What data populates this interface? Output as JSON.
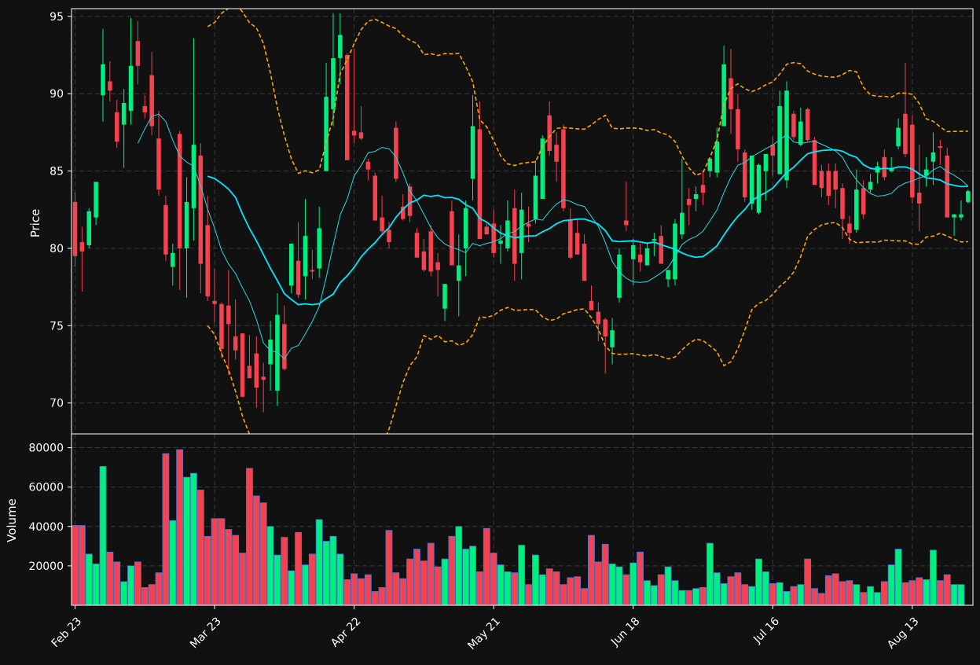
{
  "chart_data": {
    "type": "candlestick",
    "colors": {
      "background": "#111111",
      "up": "#00f080",
      "down": "#f44250",
      "sma_short": "#2ad8e0",
      "sma_long": "#00e8ff",
      "bollinger": "#ffa500",
      "grid": "#3a3a3a",
      "text": "#ffffff",
      "volume_edge": "#4a78d8"
    },
    "price_panel": {
      "ylabel": "Price",
      "ylim": [
        68,
        95.5
      ],
      "yticks": [
        70,
        75,
        80,
        85,
        90,
        95
      ]
    },
    "volume_panel": {
      "ylabel": "Volume",
      "ylim": [
        0,
        87000
      ],
      "yticks": [
        20000,
        40000,
        60000,
        80000
      ]
    },
    "x_axis": {
      "tick_labels": [
        "Feb 23",
        "Mar 23",
        "Apr 22",
        "May 21",
        "Jun 18",
        "Jul 16",
        "Aug 13"
      ],
      "tick_index": [
        0,
        20,
        40,
        60,
        80,
        100,
        120
      ],
      "n_bars": 128
    },
    "ohlc": [
      [
        83.0,
        83.6,
        78.8,
        79.5
      ],
      [
        80.4,
        81.4,
        77.2,
        79.8
      ],
      [
        80.2,
        82.6,
        80.0,
        82.4
      ],
      [
        82.0,
        84.2,
        81.5,
        84.3
      ],
      [
        89.9,
        94.2,
        88.2,
        91.9
      ],
      [
        90.8,
        92.1,
        89.5,
        90.2
      ],
      [
        88.8,
        89.6,
        86.5,
        86.9
      ],
      [
        88.0,
        90.3,
        85.2,
        89.4
      ],
      [
        88.9,
        94.9,
        88.0,
        91.8
      ],
      [
        93.4,
        94.7,
        90.6,
        91.8
      ],
      [
        89.2,
        89.9,
        88.4,
        88.8
      ],
      [
        91.2,
        92.7,
        87.3,
        87.9
      ],
      [
        87.1,
        88.9,
        83.4,
        83.8
      ],
      [
        82.8,
        83.4,
        79.2,
        79.6
      ],
      [
        78.8,
        80.3,
        77.6,
        79.7
      ],
      [
        87.4,
        87.6,
        77.3,
        80.0
      ],
      [
        80.0,
        84.6,
        76.8,
        83.0
      ],
      [
        82.6,
        93.6,
        80.5,
        86.7
      ],
      [
        86.0,
        86.8,
        77.1,
        79.0
      ],
      [
        81.5,
        83.4,
        76.6,
        76.9
      ],
      [
        76.6,
        78.7,
        75.2,
        76.4
      ],
      [
        76.4,
        76.5,
        72.9,
        73.5
      ],
      [
        76.3,
        78.6,
        71.8,
        75.1
      ],
      [
        74.3,
        76.7,
        72.8,
        73.4
      ],
      [
        74.5,
        74.4,
        70.4,
        70.4
      ],
      [
        72.4,
        74.4,
        71.6,
        71.6
      ],
      [
        73.2,
        74.3,
        69.7,
        71.0
      ],
      [
        71.7,
        72.6,
        69.4,
        71.5
      ],
      [
        72.5,
        75.3,
        70.8,
        74.1
      ],
      [
        70.8,
        77.1,
        69.8,
        75.7
      ],
      [
        75.1,
        76.3,
        72.1,
        72.2
      ],
      [
        77.6,
        80.3,
        77.1,
        80.3
      ],
      [
        79.2,
        81.7,
        76.8,
        77.0
      ],
      [
        78.2,
        83.2,
        76.7,
        80.8
      ],
      [
        78.6,
        79.9,
        78.0,
        78.5
      ],
      [
        78.7,
        82.7,
        78.1,
        81.3
      ],
      [
        85.0,
        92.0,
        85.0,
        89.8
      ],
      [
        89.0,
        95.2,
        87.9,
        92.3
      ],
      [
        92.3,
        95.2,
        90.6,
        93.8
      ],
      [
        92.5,
        92.6,
        85.8,
        85.7
      ],
      [
        87.6,
        92.9,
        86.8,
        87.3
      ],
      [
        87.5,
        89.2,
        87.0,
        87.1
      ],
      [
        85.6,
        85.8,
        84.4,
        85.1
      ],
      [
        84.7,
        84.9,
        81.8,
        81.8
      ],
      [
        82.0,
        83.4,
        81.0,
        81.1
      ],
      [
        81.2,
        81.7,
        80.0,
        80.4
      ],
      [
        87.8,
        88.2,
        84.3,
        84.5
      ],
      [
        82.7,
        83.5,
        81.8,
        81.9
      ],
      [
        84.0,
        84.2,
        81.7,
        82.1
      ],
      [
        81.0,
        81.3,
        79.5,
        79.4
      ],
      [
        79.8,
        80.6,
        78.5,
        78.6
      ],
      [
        81.1,
        81.5,
        78.2,
        78.5
      ],
      [
        79.1,
        79.7,
        76.9,
        78.6
      ],
      [
        76.1,
        77.1,
        75.3,
        77.7
      ],
      [
        82.4,
        83.1,
        79.0,
        78.9
      ],
      [
        77.9,
        80.9,
        75.6,
        78.9
      ],
      [
        80.0,
        83.1,
        78.2,
        82.6
      ],
      [
        84.5,
        89.9,
        83.1,
        87.9
      ],
      [
        87.7,
        89.5,
        80.9,
        80.6
      ],
      [
        81.4,
        81.6,
        80.9,
        80.9
      ],
      [
        81.6,
        82.5,
        79.4,
        79.7
      ],
      [
        80.3,
        81.5,
        79.0,
        80.5
      ],
      [
        80.0,
        83.1,
        79.8,
        81.8
      ],
      [
        82.6,
        83.8,
        77.9,
        79.0
      ],
      [
        79.7,
        83.6,
        78.0,
        82.5
      ],
      [
        81.6,
        82.7,
        80.4,
        81.4
      ],
      [
        81.9,
        85.7,
        81.6,
        84.7
      ],
      [
        83.2,
        87.3,
        83.3,
        87.1
      ],
      [
        88.6,
        89.5,
        86.0,
        86.3
      ],
      [
        86.7,
        87.5,
        84.3,
        85.6
      ],
      [
        87.7,
        88.0,
        82.4,
        82.6
      ],
      [
        81.8,
        82.6,
        79.3,
        79.4
      ],
      [
        81.0,
        81.9,
        80.2,
        79.6
      ],
      [
        80.3,
        80.9,
        78.0,
        77.9
      ],
      [
        76.6,
        77.6,
        76.1,
        76.0
      ],
      [
        75.9,
        76.5,
        74.0,
        75.1
      ],
      [
        75.4,
        75.5,
        71.9,
        74.3
      ],
      [
        73.6,
        75.5,
        72.5,
        74.7
      ],
      [
        76.8,
        80.0,
        76.5,
        79.6
      ],
      [
        81.8,
        84.3,
        81.1,
        81.5
      ],
      [
        79.3,
        80.6,
        77.6,
        80.2
      ],
      [
        79.6,
        80.3,
        78.5,
        79.1
      ],
      [
        78.9,
        80.4,
        79.4,
        80.0
      ],
      [
        80.5,
        81.0,
        79.5,
        80.6
      ],
      [
        80.8,
        81.5,
        79.7,
        79.0
      ],
      [
        78.0,
        78.6,
        77.5,
        78.6
      ],
      [
        78.0,
        81.9,
        77.6,
        81.6
      ],
      [
        80.9,
        85.8,
        80.6,
        82.3
      ],
      [
        83.2,
        83.9,
        81.5,
        82.8
      ],
      [
        83.2,
        84.0,
        82.4,
        83.5
      ],
      [
        84.1,
        85.0,
        82.8,
        83.6
      ],
      [
        85.0,
        85.9,
        84.6,
        85.8
      ],
      [
        84.9,
        87.8,
        84.6,
        86.9
      ],
      [
        87.9,
        93.1,
        88.0,
        91.9
      ],
      [
        91.0,
        92.9,
        87.4,
        89.0
      ],
      [
        89.0,
        90.0,
        85.6,
        86.4
      ],
      [
        86.2,
        86.4,
        83.0,
        83.3
      ],
      [
        82.9,
        86.0,
        82.5,
        86.0
      ],
      [
        82.3,
        85.5,
        82.2,
        85.4
      ],
      [
        85.0,
        86.0,
        83.1,
        86.1
      ],
      [
        86.7,
        87.2,
        84.7,
        86.0
      ],
      [
        84.8,
        90.2,
        85.2,
        89.2
      ],
      [
        84.4,
        90.8,
        83.9,
        90.2
      ],
      [
        88.7,
        88.9,
        87.0,
        87.2
      ],
      [
        86.7,
        89.1,
        86.6,
        88.2
      ],
      [
        89.0,
        89.1,
        86.9,
        87.0
      ],
      [
        87.0,
        87.2,
        84.1,
        84.1
      ],
      [
        85.0,
        85.4,
        83.3,
        83.9
      ],
      [
        85.0,
        85.5,
        82.8,
        83.4
      ],
      [
        85.0,
        85.5,
        82.6,
        83.8
      ],
      [
        83.9,
        84.2,
        80.6,
        81.9
      ],
      [
        81.6,
        82.1,
        80.3,
        81.0
      ],
      [
        81.2,
        85.1,
        81.0,
        83.8
      ],
      [
        83.9,
        84.4,
        81.9,
        82.2
      ],
      [
        83.8,
        84.8,
        83.6,
        84.3
      ],
      [
        84.9,
        85.6,
        84.2,
        85.3
      ],
      [
        85.9,
        86.4,
        84.4,
        84.6
      ],
      [
        85.0,
        85.9,
        84.9,
        85.2
      ],
      [
        86.6,
        88.4,
        86.4,
        87.8
      ],
      [
        88.7,
        92.0,
        85.9,
        86.1
      ],
      [
        88.0,
        88.6,
        82.9,
        83.3
      ],
      [
        83.6,
        86.7,
        81.1,
        82.9
      ],
      [
        84.7,
        85.9,
        84.0,
        85.1
      ],
      [
        85.6,
        87.5,
        84.1,
        86.2
      ],
      [
        86.6,
        87.0,
        85.4,
        86.5
      ],
      [
        86.0,
        86.5,
        82.0,
        82.0
      ],
      [
        82.0,
        82.2,
        80.8,
        82.2
      ],
      [
        82.0,
        83.1,
        81.8,
        82.2
      ],
      [
        83.0,
        83.8,
        82.9,
        83.7
      ]
    ],
    "volume": [
      40500,
      40500,
      26000,
      21000,
      70500,
      27000,
      22000,
      12000,
      20000,
      22000,
      9000,
      10500,
      16500,
      77000,
      43000,
      79000,
      65000,
      67000,
      58500,
      35000,
      44000,
      44000,
      38500,
      35500,
      26500,
      69500,
      55500,
      52000,
      40000,
      25500,
      34500,
      17500,
      37000,
      20500,
      26000,
      43500,
      32500,
      35000,
      26000,
      13000,
      16000,
      13500,
      15500,
      7000,
      9000,
      38000,
      16500,
      13500,
      23500,
      28500,
      22500,
      31500,
      19500,
      23500,
      35000,
      40000,
      28500,
      30000,
      17000,
      39000,
      26500,
      20500,
      17000,
      16500,
      30500,
      10500,
      25500,
      15500,
      18500,
      17000,
      10500,
      14000,
      14500,
      8500,
      35500,
      22000,
      31000,
      21000,
      19500,
      15500,
      21500,
      27000,
      12500,
      10000,
      15500,
      19500,
      12500,
      7500,
      7500,
      8500,
      9000,
      31500,
      16500,
      11000,
      14500,
      16500,
      10500,
      9500,
      23500,
      17000,
      11000,
      11500,
      7000,
      9500,
      10500,
      23500,
      8500,
      6000,
      15000,
      16000,
      12000,
      12500,
      10500,
      6500,
      9500,
      6500,
      12000,
      20500,
      28500,
      11500,
      12500,
      14000,
      13000,
      28000,
      12500,
      15500,
      10500,
      10500
    ]
  }
}
